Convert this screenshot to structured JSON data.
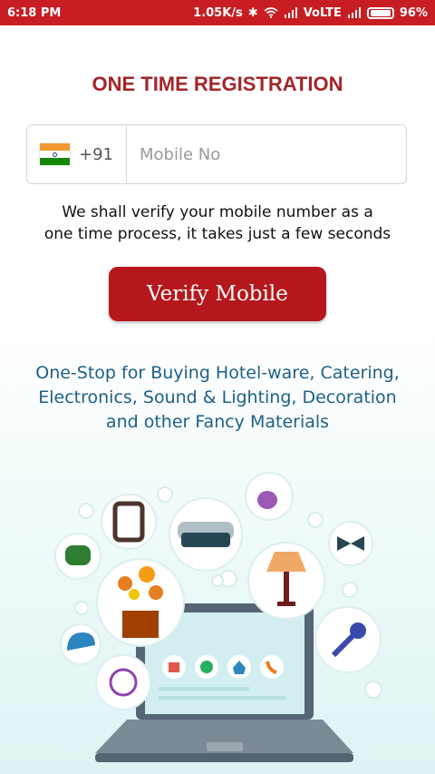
{
  "status_bar": {
    "time": "6:18 PM",
    "speed": "1.05K/s",
    "network": "VoLTE",
    "battery": "96%",
    "battery_level": 0.96
  },
  "registration": {
    "title": "ONE TIME REGISTRATION",
    "country_code": "+91",
    "mobile_placeholder": "Mobile No",
    "verify_note_line1": "We shall verify your mobile number as a",
    "verify_note_line2": "one time process, it takes just a few seconds",
    "verify_button": "Verify Mobile"
  },
  "tagline": {
    "line1": "One-Stop for Buying Hotel-ware, Catering,",
    "line2": "Electronics, Sound & Lighting, Decoration",
    "line3": "and other Fancy Materials"
  },
  "colors": {
    "status_bar": "#c71d23",
    "title": "#a3262a",
    "button": "#b5171c",
    "tagline": "#1f5f86"
  }
}
